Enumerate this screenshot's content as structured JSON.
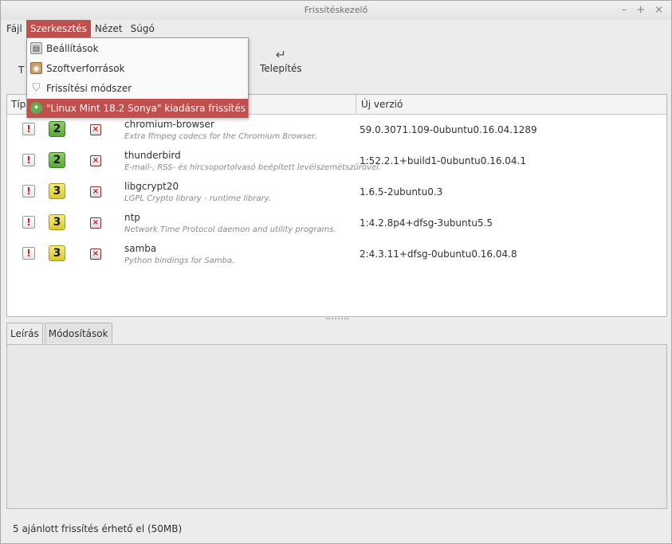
{
  "window": {
    "title": "Frissítéskezelő",
    "controls": [
      "–",
      "+",
      "×"
    ]
  },
  "menubar": [
    "Fájl",
    "Szerkesztés",
    "Nézet",
    "Súgó"
  ],
  "toolbar": {
    "partial_label": "T",
    "install_label": "Telepítés",
    "install_icon": "↵"
  },
  "dropdown": {
    "items": [
      {
        "label": "Beállítások",
        "icon": "settings-icon"
      },
      {
        "label": "Szoftverforrások",
        "icon": "software-sources-icon"
      },
      {
        "label": "Frissítési módszer",
        "icon": "shield-icon"
      },
      {
        "label": "\"Linux Mint 18.2 Sonya\" kiadásra frissítés",
        "icon": "mint-upgrade-icon"
      }
    ]
  },
  "table": {
    "headers": {
      "type": "Típ",
      "new_version": "Új verzió"
    },
    "rows": [
      {
        "level": "2",
        "name": "chromium-browser",
        "desc": "Extra ffmpeg codecs for the Chromium Browser.",
        "version": "59.0.3071.109-0ubuntu0.16.04.1289"
      },
      {
        "level": "2",
        "name": "thunderbird",
        "desc": "E-mail-, RSS- és hírcsoportolvasó beépített levélszemétszűrővel.",
        "version": "1:52.2.1+build1-0ubuntu0.16.04.1"
      },
      {
        "level": "3",
        "name": "libgcrypt20",
        "desc": "LGPL Crypto library - runtime library.",
        "version": "1.6.5-2ubuntu0.3"
      },
      {
        "level": "3",
        "name": "ntp",
        "desc": "Network Time Protocol daemon and utility programs.",
        "version": "1:4.2.8p4+dfsg-3ubuntu5.5"
      },
      {
        "level": "3",
        "name": "samba",
        "desc": "Python bindings for Samba.",
        "version": "2:4.3.11+dfsg-0ubuntu0.16.04.8"
      }
    ]
  },
  "tabs": [
    "Leírás",
    "Módosítások"
  ],
  "status": "5 ajánlott frissítés érhető el (50MB)"
}
